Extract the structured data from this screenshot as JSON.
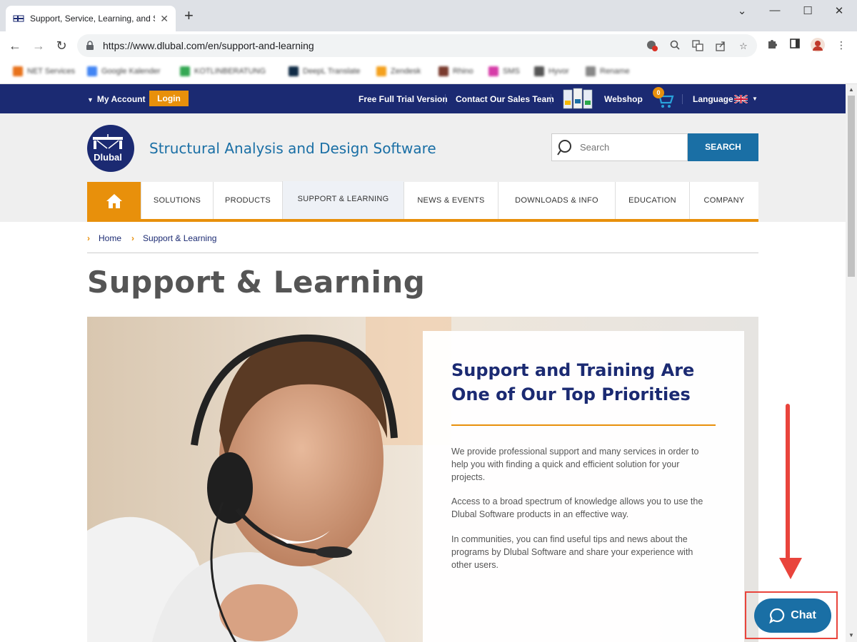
{
  "browser": {
    "tab_title": "Support, Service, Learning, and Sup",
    "url": "https://www.dlubal.com/en/support-and-learning",
    "bookmarks": [
      {
        "label": "NET Services",
        "color": "#e8731c"
      },
      {
        "label": "Google Kalender",
        "color": "#4285f4"
      },
      {
        "label": "KOTLINBERATUNG",
        "color": "#34a853"
      },
      {
        "label": "DeepL Translate",
        "color": "#0f2b46"
      },
      {
        "label": "Zendesk",
        "color": "#f4a11d"
      },
      {
        "label": "Rhino",
        "color": "#7a3b2e"
      },
      {
        "label": "SMS",
        "color": "#d63ca8"
      },
      {
        "label": "Hyvor",
        "color": "#555555"
      },
      {
        "label": "Rename",
        "color": "#888888"
      }
    ]
  },
  "topbar": {
    "my_account": "My Account",
    "login": "Login",
    "free_trial": "Free Full Trial Version",
    "contact_sales": "Contact Our Sales Team",
    "webshop": "Webshop",
    "cart_count": "0",
    "language": "Language"
  },
  "header": {
    "logo_text": "Dlubal",
    "tagline": "Structural Analysis and Design Software",
    "search_placeholder": "Search",
    "search_button": "SEARCH"
  },
  "nav": {
    "items": [
      {
        "label": "SOLUTIONS"
      },
      {
        "label": "PRODUCTS"
      },
      {
        "label": "SUPPORT & LEARNING"
      },
      {
        "label": "NEWS & EVENTS"
      },
      {
        "label": "DOWNLOADS & INFO"
      },
      {
        "label": "EDUCATION"
      },
      {
        "label": "COMPANY"
      }
    ],
    "active": "SUPPORT & LEARNING"
  },
  "breadcrumb": {
    "home": "Home",
    "current": "Support & Learning"
  },
  "page": {
    "title": "Support & Learning",
    "card_title": "Support and Training Are One of Our Top Priorities",
    "paragraphs": [
      "We provide professional support and many services in order to help you with finding a quick and efficient solution for your projects.",
      "Access to a broad spectrum of knowledge allows you to use the Dlubal Software products in an effective way.",
      "In communities, you can find useful tips and news about the programs by Dlubal Software and share your experience with other users."
    ]
  },
  "chat": {
    "label": "Chat"
  },
  "colors": {
    "brand_navy": "#1b2a72",
    "brand_blue": "#1a6fa5",
    "accent_orange": "#e8900b",
    "annotation_red": "#e9443c"
  }
}
